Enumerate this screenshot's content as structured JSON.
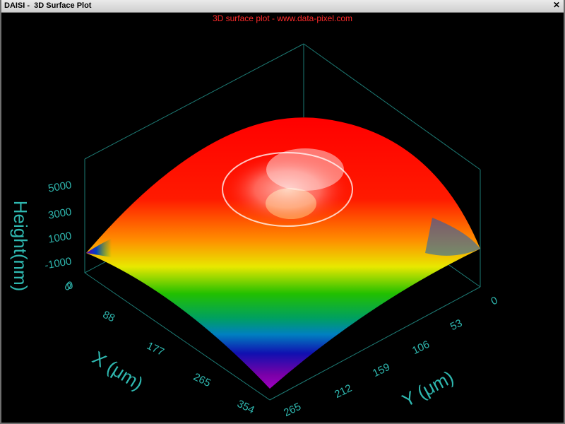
{
  "window": {
    "title": "DAISI -  3D Surface Plot",
    "close_glyph": "✕"
  },
  "colors": {
    "background": "#000000",
    "title": "#ff2a2a",
    "axis": "#2fb8b0",
    "frame": "#1d7a74"
  },
  "chart_data": {
    "type": "surface",
    "title": "3D surface plot - www.data-pixel.com",
    "xlabel": "X (μm)",
    "ylabel": "Y (μm)",
    "zlabel": "Height(nm)",
    "x_ticks": [
      "0",
      "88",
      "177",
      "265",
      "354"
    ],
    "y_ticks": [
      "0",
      "53",
      "106",
      "159",
      "212",
      "265"
    ],
    "z_ticks": [
      "0",
      "-1000",
      "1000",
      "3000",
      "5000"
    ],
    "xlim": [
      0,
      354
    ],
    "ylim": [
      0,
      265
    ],
    "colormap": "rainbow (red high, purple low)"
  }
}
